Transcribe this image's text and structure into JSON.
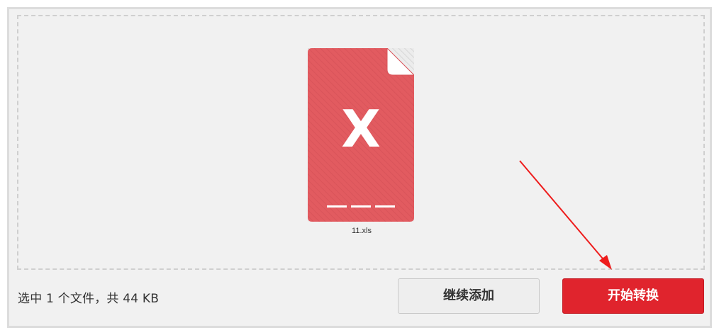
{
  "file": {
    "name": "11.xls",
    "icon_letter": "X",
    "icon_color": "#e25b60"
  },
  "footer": {
    "summary": "选中 1 个文件，共 44 KB",
    "add_label": "继续添加",
    "start_label": "开始转换"
  },
  "colors": {
    "start_button": "#e0242d",
    "annotation_arrow": "#ee1c1c"
  },
  "icons": {
    "file": "excel-file-icon",
    "annotation": "red-arrow-annotation"
  }
}
